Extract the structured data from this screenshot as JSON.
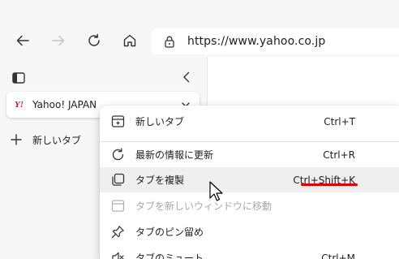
{
  "toolbar": {
    "back_icon": "arrow-left-icon",
    "forward_icon": "arrow-right-icon",
    "refresh_icon": "refresh-icon",
    "home_icon": "home-icon",
    "address": {
      "lock_icon": "lock-icon",
      "url": "https://www.yahoo.co.jp"
    }
  },
  "sidebar": {
    "tab": {
      "favicon_text": "Y!",
      "title": "Yahoo! JAPAN"
    },
    "new_tab_label": "新しいタブ"
  },
  "context_menu": {
    "items": [
      {
        "label": "新しいタブ",
        "shortcut": "Ctrl+T",
        "icon": "new-tab-icon",
        "disabled": false
      },
      {
        "label": "最新の情報に更新",
        "shortcut": "Ctrl+R",
        "icon": "refresh-icon",
        "disabled": false
      },
      {
        "label": "タブを複製",
        "shortcut": "Ctrl+Shift+K",
        "icon": "duplicate-tab-icon",
        "disabled": false,
        "hovered": true
      },
      {
        "label": "タブを新しいウィンドウに移動",
        "shortcut": "",
        "icon": "move-window-icon",
        "disabled": true
      },
      {
        "label": "タブのピン留め",
        "shortcut": "",
        "icon": "pin-icon",
        "disabled": false
      },
      {
        "label": "タブのミュート",
        "shortcut": "Ctrl+M",
        "icon": "mute-icon",
        "disabled": false
      }
    ]
  },
  "colors": {
    "highlight_underline": "#e00000",
    "yahoo_red": "#ff0033"
  }
}
